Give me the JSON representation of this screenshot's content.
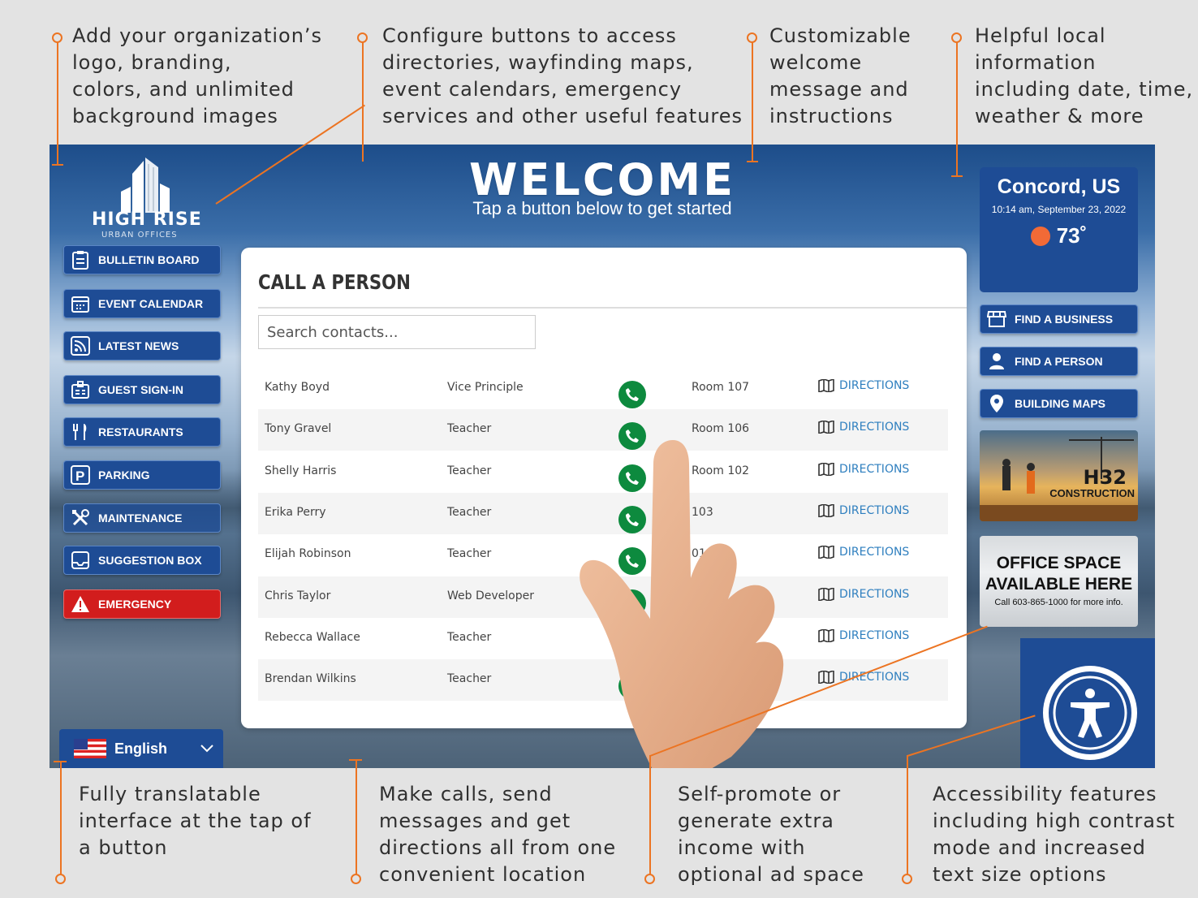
{
  "callouts": {
    "top": [
      "Add your organization’s\nlogo, branding,\ncolors, and unlimited\nbackground images",
      "Configure buttons to access\ndirectories, wayfinding maps,\nevent calendars, emergency\nservices and other useful features",
      "Customizable\nwelcome\nmessage and\ninstructions",
      "Helpful local\ninformation\nincluding date, time,\nweather & more"
    ],
    "bottom": [
      "Fully translatable\ninterface at the tap of\na button",
      "Make calls, send\nmessages and get\ndirections all from one\nconvenient location",
      "Self-promote or\ngenerate extra\nincome with\noptional ad space",
      "Accessibility features\nincluding high contrast\nmode and increased\ntext size options"
    ]
  },
  "colors": {
    "accent": "#ec7422",
    "brand_blue": "#1e4c95",
    "emergency_red": "#d21d1d",
    "call_green": "#0d8a3e",
    "link_blue": "#2f7fbf"
  },
  "kiosk": {
    "logo": {
      "title": "HIGH RISE",
      "subtitle": "URBAN OFFICES"
    },
    "welcome": {
      "title": "WELCOME",
      "subtitle": "Tap a button below to get started"
    },
    "nav": [
      {
        "label": "BULLETIN BOARD",
        "icon": "clipboard-icon"
      },
      {
        "label": "EVENT CALENDAR",
        "icon": "calendar-icon"
      },
      {
        "label": "LATEST NEWS",
        "icon": "rss-icon"
      },
      {
        "label": "GUEST SIGN-IN",
        "icon": "badge-icon"
      },
      {
        "label": "RESTAURANTS",
        "icon": "utensils-icon"
      },
      {
        "label": "PARKING",
        "icon": "parking-icon"
      },
      {
        "label": "MAINTENANCE",
        "icon": "tools-icon"
      },
      {
        "label": "SUGGESTION BOX",
        "icon": "inbox-icon"
      },
      {
        "label": "EMERGENCY",
        "icon": "warning-icon"
      }
    ],
    "weather": {
      "city": "Concord, US",
      "datetime": "10:14 am, September 23, 2022",
      "temp": "73˚",
      "icon": "sun-icon"
    },
    "right_nav": [
      {
        "label": "FIND A BUSINESS",
        "icon": "storefront-icon"
      },
      {
        "label": "FIND A PERSON",
        "icon": "person-icon"
      },
      {
        "label": "BUILDING MAPS",
        "icon": "map-pin-icon"
      }
    ],
    "ads": {
      "construction": {
        "title": "H32",
        "subtitle": "CONSTRUCTION"
      },
      "office": {
        "line1": "OFFICE SPACE",
        "line2": "AVAILABLE HERE",
        "line3": "Call 603-865-1000 for more info."
      }
    },
    "language": {
      "label": "English",
      "icon": "us-flag-icon"
    },
    "panel": {
      "title": "CALL A PERSON",
      "search_placeholder": "Search contacts...",
      "directions_label": "DIRECTIONS",
      "rows": [
        {
          "name": "Kathy Boyd",
          "role": "Vice Principle",
          "room": "Room 107"
        },
        {
          "name": "Tony Gravel",
          "role": "Teacher",
          "room": "Room 106"
        },
        {
          "name": "Shelly Harris",
          "role": "Teacher",
          "room": "Room 102"
        },
        {
          "name": "Erika Perry",
          "role": "Teacher",
          "room": "103"
        },
        {
          "name": "Elijah Robinson",
          "role": "Teacher",
          "room": "01"
        },
        {
          "name": "Chris Taylor",
          "role": "Web Developer",
          "room": ""
        },
        {
          "name": "Rebecca Wallace",
          "role": "Teacher",
          "room": ""
        },
        {
          "name": "Brendan Wilkins",
          "role": "Teacher",
          "room": ""
        }
      ]
    }
  }
}
